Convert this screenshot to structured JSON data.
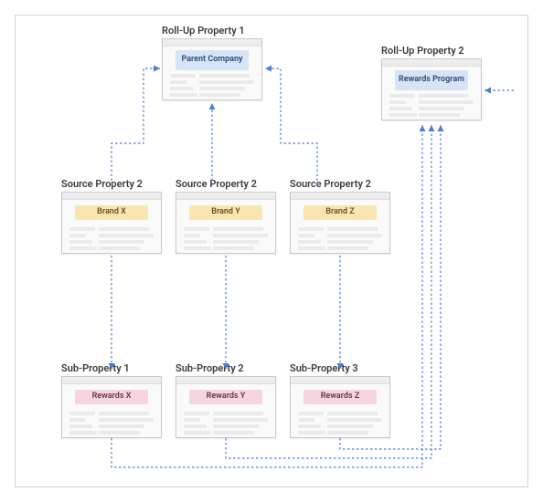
{
  "diagram": {
    "rollup1": {
      "title": "Roll-Up Property 1",
      "label": "Parent Company"
    },
    "rollup2": {
      "title": "Roll-Up Property 2",
      "label": "Rewards Program"
    },
    "source1": {
      "title": "Source Property 2",
      "label": "Brand X"
    },
    "source2": {
      "title": "Source Property 2",
      "label": "Brand Y"
    },
    "source3": {
      "title": "Source Property 2",
      "label": "Brand Z"
    },
    "sub1": {
      "title": "Sub-Property 1",
      "label": "Rewards X"
    },
    "sub2": {
      "title": "Sub-Property 2",
      "label": "Rewards Y"
    },
    "sub3": {
      "title": "Sub-Property 3",
      "label": "Rewards Z"
    }
  }
}
